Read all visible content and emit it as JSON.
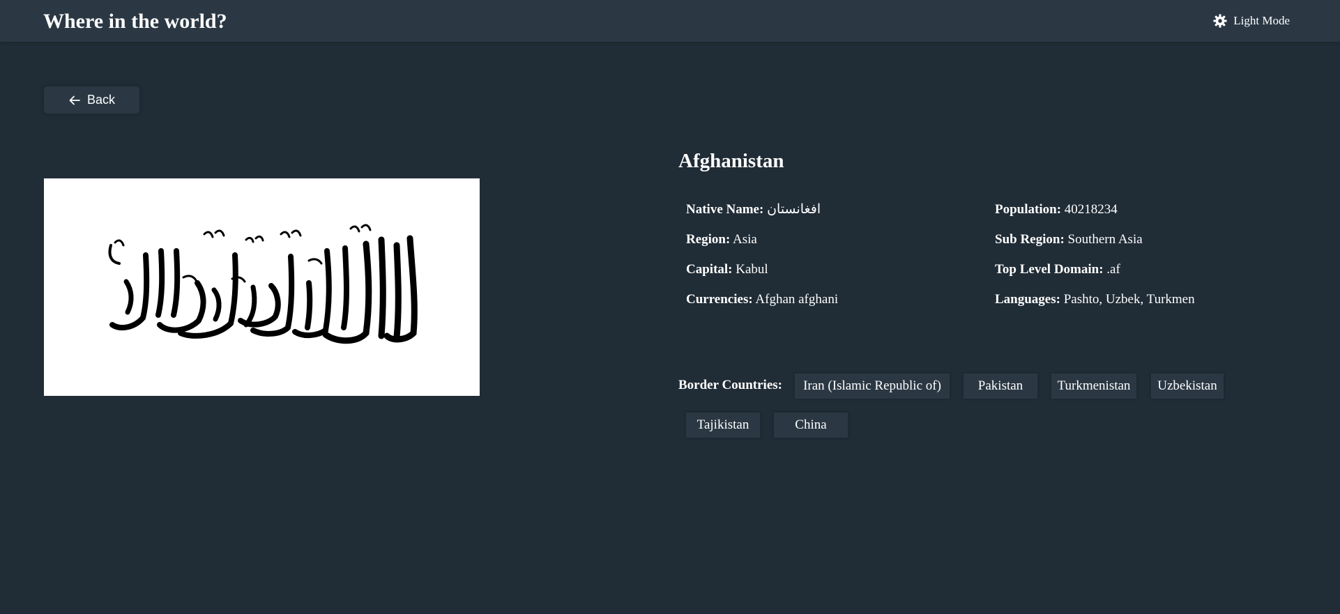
{
  "header": {
    "title": "Where in the world?",
    "theme_toggle_label": "Light Mode",
    "theme_icon": "sun-gear-icon"
  },
  "back": {
    "label": "Back",
    "icon": "arrow-left-icon"
  },
  "country": {
    "name": "Afghanistan",
    "flag_alt": "Flag of Afghanistan",
    "details_left": [
      {
        "label": "Native Name:",
        "value": "افغانستان"
      },
      {
        "label": "Region:",
        "value": "Asia"
      },
      {
        "label": "Capital:",
        "value": "Kabul"
      },
      {
        "label": "Currencies:",
        "value": "Afghan afghani"
      }
    ],
    "details_right": [
      {
        "label": "Population:",
        "value": "40218234"
      },
      {
        "label": "Sub Region:",
        "value": "Southern Asia"
      },
      {
        "label": "Top Level Domain:",
        "value": ".af"
      },
      {
        "label": "Languages:",
        "value": "Pashto, Uzbek, Turkmen"
      }
    ],
    "border_label": "Border Countries:",
    "borders": [
      "Iran (Islamic Republic of)",
      "Pakistan",
      "Turkmenistan",
      "Uzbekistan",
      "Tajikistan",
      "China"
    ]
  },
  "colors": {
    "background": "#202c36",
    "surface": "#2b3844",
    "text": "#ffffff"
  }
}
